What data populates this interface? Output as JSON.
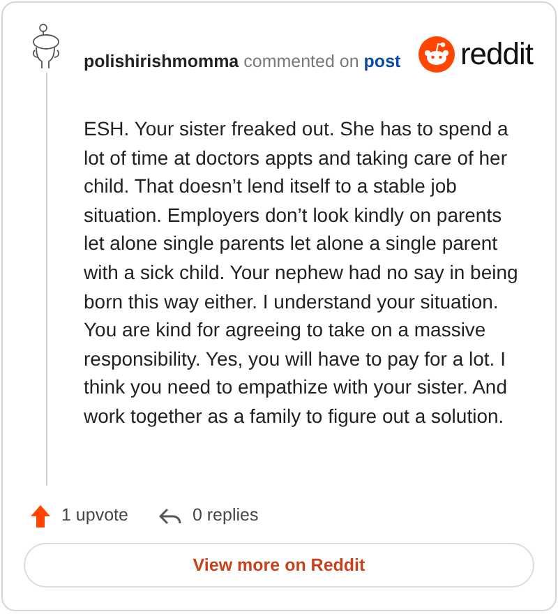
{
  "author": "polishirishmomma",
  "action": "commented on",
  "link": "post",
  "brand": "reddit",
  "body": "ESH. Your sister freaked out. She has to spend a lot of time at doctors appts and taking care of her child. That doesn’t lend itself to a stable job situation. Employers don’t look kindly on parents let alone single parents let alone a single parent with a sick child. Your nephew had no say in being born this way either. I understand your situation. You are kind for agreeing to take on a massive responsibility. Yes, you will have to pay for a lot. I think you need to empathize with your sister. And work together as a family to figure out a solution.",
  "upvotes": "1 upvote",
  "replies": "0 replies",
  "button": "View more on Reddit"
}
